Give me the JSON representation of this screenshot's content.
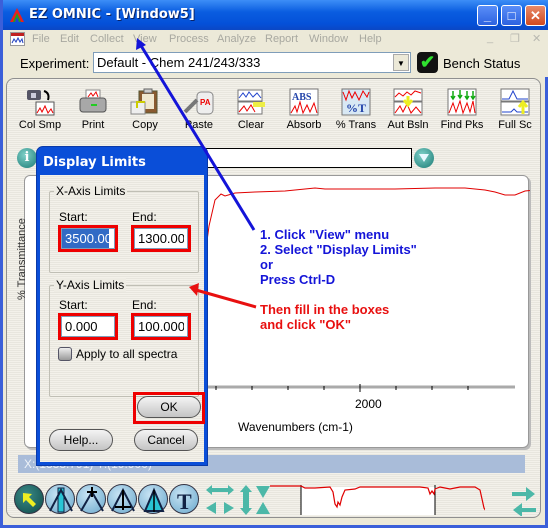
{
  "window": {
    "title": "EZ OMNIC - [Window5]",
    "minimize": "_",
    "maximize": "□",
    "close": "✕"
  },
  "menu": {
    "items": [
      "File",
      "Edit",
      "Collect",
      "View",
      "Process",
      "Analyze",
      "Report",
      "Window",
      "Help"
    ],
    "mdi_controls": [
      "_",
      "❐",
      "✕"
    ]
  },
  "experiment": {
    "label": "Experiment:",
    "value": "Default - Chem 241/243/333",
    "bench_status": "Bench Status"
  },
  "toolbar": {
    "buttons": [
      {
        "label": "Col Smp",
        "icon": "collect-sample-icon"
      },
      {
        "label": "Print",
        "icon": "printer-icon"
      },
      {
        "label": "Copy",
        "icon": "clipboard-copy-icon"
      },
      {
        "label": "Paste",
        "icon": "paste-icon"
      },
      {
        "label": "Clear",
        "icon": "clear-spectrum-icon"
      },
      {
        "label": "Absorb",
        "icon": "absorbance-icon"
      },
      {
        "label": "% Trans",
        "icon": "transmittance-icon"
      },
      {
        "label": "Aut Bsln",
        "icon": "auto-baseline-icon"
      },
      {
        "label": "Find Pks",
        "icon": "find-peaks-icon"
      },
      {
        "label": "Full Sc",
        "icon": "full-scale-icon"
      }
    ]
  },
  "spectrum": {
    "title_value": "",
    "y_axis_label": "% Transmittance",
    "x_axis_label": "Wavenumbers (cm-1)",
    "x_tick_label": "2000",
    "line_color": "#e00000"
  },
  "status": {
    "cursor": "X:(1338.791) Y:(19.900)"
  },
  "dialog": {
    "title": "Display Limits",
    "x_group": "X-Axis Limits",
    "x_start_label": "Start:",
    "x_end_label": "End:",
    "x_start": "3500.00",
    "x_end": "1300.00",
    "y_group": "Y-Axis Limits",
    "y_start_label": "Start:",
    "y_end_label": "End:",
    "y_start": "0.000",
    "y_end": "100.000",
    "apply_all": "Apply to all spectra",
    "apply_all_checked": false,
    "ok": "OK",
    "help": "Help...",
    "cancel": "Cancel"
  },
  "annotations": {
    "blue_lines": [
      "1. Click \"View\" menu",
      "2. Select \"Display Limits\"",
      "or",
      "Press Ctrl-D"
    ],
    "red_lines": [
      "Then fill in the boxes",
      "and click \"OK\""
    ],
    "blue_color": "#1414d8",
    "red_color": "#e81010"
  },
  "bottom_toolbar": {
    "tools": [
      "select-arrow-icon",
      "region-tool-icon",
      "peak-label-icon",
      "peak-height-icon",
      "peak-area-icon",
      "text-tool-icon",
      "expand-contract-horizontal-icon",
      "expand-vertical-icon",
      "contract-vertical-icon"
    ]
  }
}
